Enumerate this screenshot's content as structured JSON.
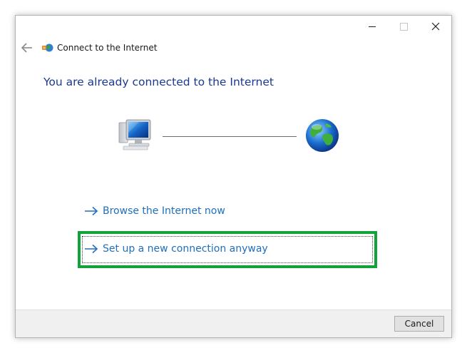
{
  "window": {
    "title": "Connect to the Internet",
    "heading": "You are already connected to the Internet"
  },
  "icons": {
    "back": "back-arrow-icon",
    "app": "network-connection-icon",
    "computer": "computer-icon",
    "globe": "globe-icon",
    "command_arrow": "arrow-right-icon"
  },
  "links": {
    "browse": "Browse the Internet now",
    "setup": "Set up a new connection anyway"
  },
  "footer": {
    "cancel_label": "Cancel"
  },
  "colors": {
    "heading": "#1a3a8f",
    "link": "#1f6fbd",
    "highlight": "#13a239",
    "footer_bg": "#f0f0f0"
  }
}
